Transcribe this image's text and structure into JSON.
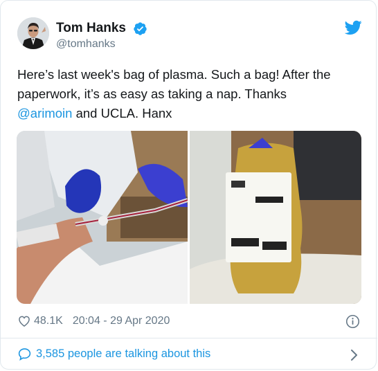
{
  "author": {
    "name": "Tom Hanks",
    "handle": "@tomhanks",
    "verified": true
  },
  "tweet": {
    "line1": "Here’s last week's bag of plasma. Such a bag!  After the",
    "line2": "paperwork, it’s as easy as taking a nap.  Thanks",
    "mention": "@arimoin",
    "line3_rest": " and UCLA. Hanx"
  },
  "stats": {
    "likes": "48.1K",
    "timestamp": "20:04 - 29 Apr 2020"
  },
  "footer": {
    "talking": "3,585 people are talking about this"
  },
  "icons": {
    "verified": "verified-badge-icon",
    "logo": "twitter-bird-icon",
    "like": "heart-icon",
    "info": "info-icon",
    "reply": "speech-bubble-icon",
    "more": "chevron-right-icon"
  },
  "colors": {
    "link": "#1b95e0",
    "muted": "#657786",
    "text": "#14171a",
    "verified": "#1da1f2"
  }
}
